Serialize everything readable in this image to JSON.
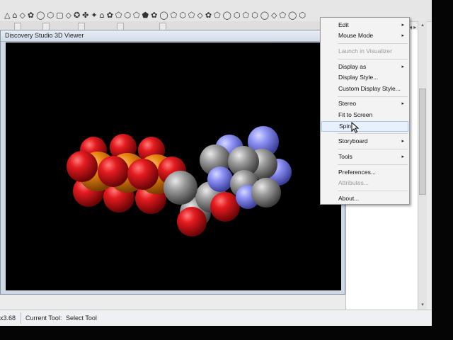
{
  "toolbar": {
    "shapes": [
      "△",
      "⌂",
      "◇",
      "✿",
      "◯",
      "⬡",
      "▢",
      "◇",
      "✪",
      "✤",
      "✦",
      "⌂",
      "✿",
      "⬠",
      "⬡",
      "⬠",
      "⬟",
      "✿",
      "◯",
      "⬠",
      "⬡",
      "⬠",
      "◇",
      "✿",
      "⬠",
      "◯",
      "⬡",
      "⬠",
      "⬡",
      "◯",
      "◇",
      "⬠",
      "◯",
      "⬡"
    ]
  },
  "viewer": {
    "title": "Discovery Studio 3D Viewer"
  },
  "status": {
    "coord": "x3.68",
    "tool_label": "Current Tool:",
    "tool_value": "Select Tool"
  },
  "menu": {
    "items": [
      {
        "label": "Edit",
        "submenu": true,
        "disabled": false
      },
      {
        "label": "Mouse Mode",
        "submenu": true,
        "disabled": false
      },
      {
        "label": "Launch in Visualizer",
        "submenu": false,
        "disabled": true
      },
      {
        "label": "Display as",
        "submenu": true,
        "disabled": false
      },
      {
        "label": "Display Style...",
        "submenu": false,
        "disabled": false
      },
      {
        "label": "Custom Display Style...",
        "submenu": false,
        "disabled": false
      },
      {
        "label": "Stereo",
        "submenu": true,
        "disabled": false
      },
      {
        "label": "Fit to Screen",
        "submenu": false,
        "disabled": false
      },
      {
        "label": "Spin",
        "submenu": false,
        "disabled": false,
        "highlighted": true
      },
      {
        "label": "Storyboard",
        "submenu": true,
        "disabled": false
      },
      {
        "label": "Tools",
        "submenu": true,
        "disabled": false
      },
      {
        "label": "Preferences...",
        "submenu": false,
        "disabled": false
      },
      {
        "label": "Attributes...",
        "submenu": false,
        "disabled": true
      },
      {
        "label": "About...",
        "submenu": false,
        "disabled": false
      }
    ],
    "submenu_arrow": "▸"
  },
  "colors": {
    "oxygen": "#e0141a",
    "phosphorus": "#e8830f",
    "carbon": "#9a9a9a",
    "nitrogen": "#8a8ff2",
    "background": "#000000",
    "menu_highlight": "#e8f1fb"
  },
  "icons": {
    "submenu": "chevron-right-icon",
    "cursor": "arrow-cursor-icon"
  }
}
